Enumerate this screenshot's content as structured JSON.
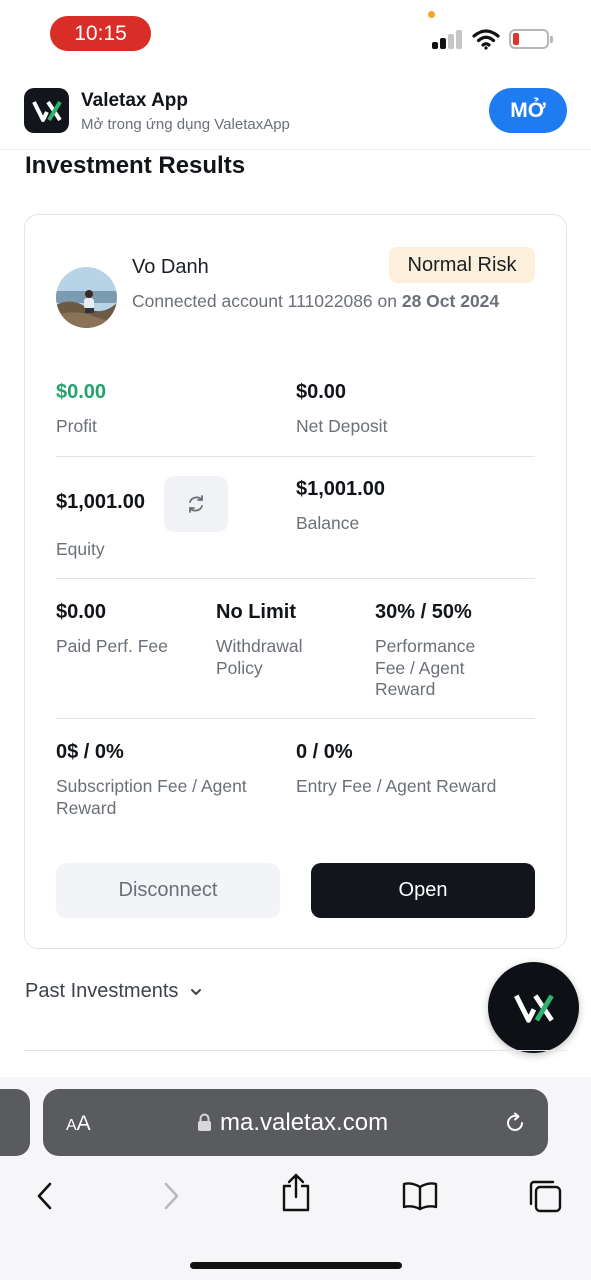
{
  "status_bar": {
    "time": "10:15"
  },
  "app_banner": {
    "name": "Valetax App",
    "subtitle": "Mở trong ứng dụng ValetaxApp",
    "open_label": "MỞ"
  },
  "page_title": "Investment Results",
  "card": {
    "user_name": "Vo Danh",
    "connected_prefix": "Connected account 111022086 on ",
    "connected_date": "28 Oct 2024",
    "risk_badge": "Normal Risk",
    "stats": {
      "profit": {
        "value": "$0.00",
        "label": "Profit"
      },
      "net_deposit": {
        "value": "$0.00",
        "label": "Net Deposit"
      },
      "equity": {
        "value": "$1,001.00",
        "label": "Equity"
      },
      "balance": {
        "value": "$1,001.00",
        "label": "Balance"
      },
      "paid_perf_fee": {
        "value": "$0.00",
        "label": "Paid Perf. Fee"
      },
      "withdrawal_policy": {
        "value": "No Limit",
        "label": "Withdrawal Policy"
      },
      "performance_fee": {
        "value": "30% / 50%",
        "label": "Performance Fee / Agent Reward"
      },
      "subscription_fee": {
        "value": "0$ / 0%",
        "label": "Subscription Fee / Agent Reward"
      },
      "entry_fee": {
        "value": "0 / 0%",
        "label": "Entry Fee / Agent Reward"
      }
    },
    "disconnect_label": "Disconnect",
    "open_label": "Open"
  },
  "past_investments_label": "Past Investments",
  "browser": {
    "text_size_label_large": "A",
    "text_size_label_small": "A",
    "url": "ma.valetax.com"
  },
  "icons": {
    "refresh": "refresh-icon",
    "chevron": "chevron-down-icon",
    "lock": "lock-icon",
    "reload": "reload-icon",
    "back": "back-icon",
    "forward": "forward-icon",
    "share": "share-icon",
    "bookmarks": "bookmarks-icon",
    "tabs": "tabs-icon"
  },
  "colors": {
    "profit_green": "#25a36c",
    "banner_button": "#1e7cf0",
    "risk_badge_bg": "#fcf0dc",
    "status_time_bg": "#d92d27"
  }
}
